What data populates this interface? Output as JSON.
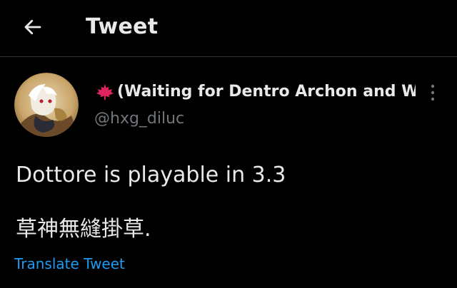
{
  "header": {
    "title": "Tweet",
    "back_icon": "arrow-left-icon"
  },
  "author": {
    "display_name": "(Waiting for Dentro Archon and W...",
    "name_prefix_icon": "maple-leaf-icon",
    "handle": "@hxg_diluc",
    "avatar_icon": "avatar"
  },
  "tweet": {
    "line1": "Dottore is playable in 3.3",
    "line2": "草神無縫掛草.",
    "translate_label": "Translate Tweet"
  },
  "more_icon": "more-vertical-icon",
  "colors": {
    "background": "#000000",
    "text": "#e7e9ea",
    "secondary_text": "#71767b",
    "link": "#1d9bf0",
    "divider": "#2f3336",
    "maple": "#e0245e"
  }
}
